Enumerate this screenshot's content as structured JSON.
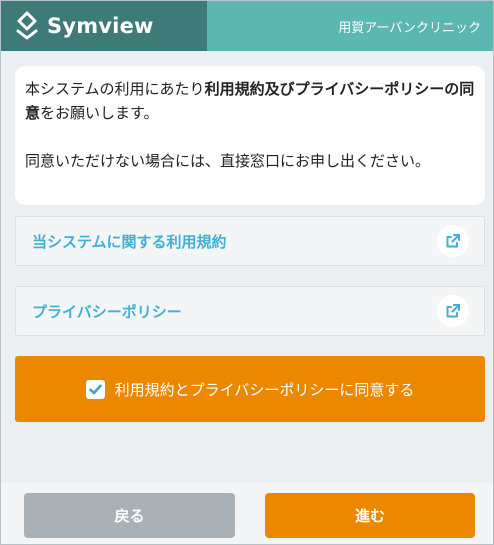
{
  "header": {
    "brand": "Symview",
    "clinic": "用賀アーバンクリニック"
  },
  "message": {
    "line1_pre": "本システムの利用にあたり",
    "line1_bold": "利用規約及びプライバシーポリシーの同意",
    "line1_post": "をお願いします。",
    "line2": "同意いただけない場合には、直接窓口にお申し出ください。"
  },
  "links": {
    "terms_label": "当システムに関する利用規約",
    "privacy_label": "プライバシーポリシー"
  },
  "agree": {
    "label": "利用規約とプライバシーポリシーに同意する",
    "checked": true
  },
  "footer": {
    "back_label": "戻る",
    "next_label": "進む"
  },
  "colors": {
    "brand_dark": "#3e7a78",
    "brand_light": "#5db7b1",
    "accent_orange": "#eb8800",
    "link_blue": "#3fb0d6",
    "button_gray": "#a9b1b6"
  },
  "icons": {
    "brand": "symview-logo-icon",
    "external": "external-link-icon",
    "check": "check-icon"
  }
}
